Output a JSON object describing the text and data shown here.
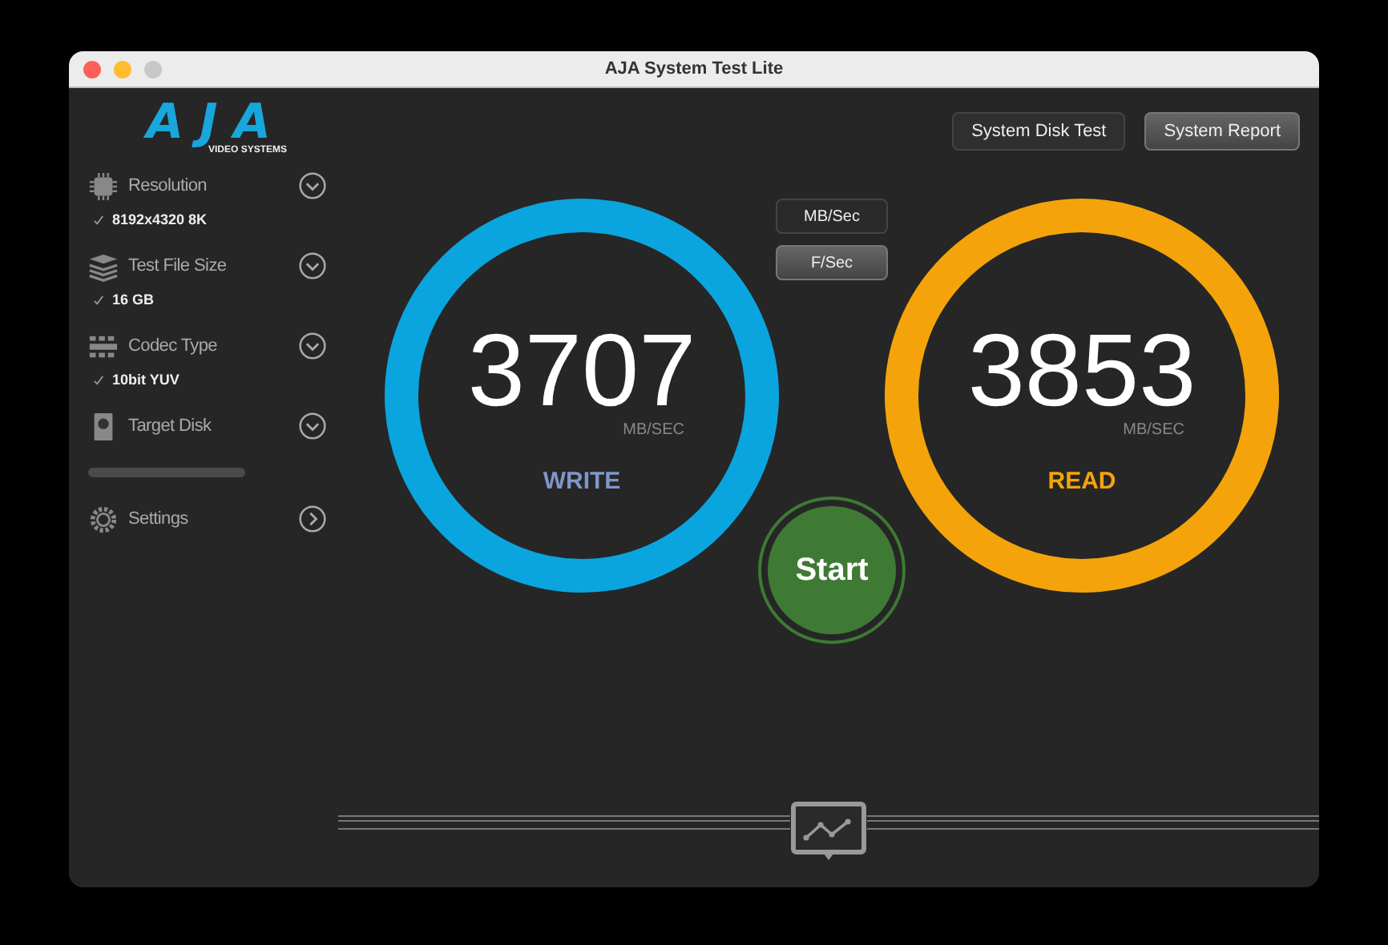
{
  "window": {
    "title": "AJA System Test Lite"
  },
  "logo": {
    "text": "AJA",
    "subtitle": "VIDEO SYSTEMS"
  },
  "sidebar": {
    "items": [
      {
        "kind": "dropdown",
        "label": "Resolution",
        "value": "8192x4320 8K"
      },
      {
        "kind": "dropdown",
        "label": "Test File Size",
        "value": "16 GB"
      },
      {
        "kind": "dropdown",
        "label": "Codec Type",
        "value": "10bit YUV"
      },
      {
        "kind": "dropdown",
        "label": "Target Disk"
      },
      {
        "kind": "progress",
        "level": 0
      },
      {
        "kind": "link",
        "label": "Settings"
      }
    ]
  },
  "top_buttons": [
    "System Disk Test",
    "System Report"
  ],
  "units": [
    {
      "label": "MB/Sec",
      "selected": true
    },
    {
      "label": "F/Sec",
      "selected": false
    }
  ],
  "gauges": [
    {
      "value": "3707",
      "unit": "MB/SEC",
      "label": "WRITE",
      "color": "#0aa5de"
    },
    {
      "value": "3853",
      "unit": "MB/SEC",
      "label": "READ",
      "color": "#f4a40a"
    }
  ],
  "start_button": "Start"
}
